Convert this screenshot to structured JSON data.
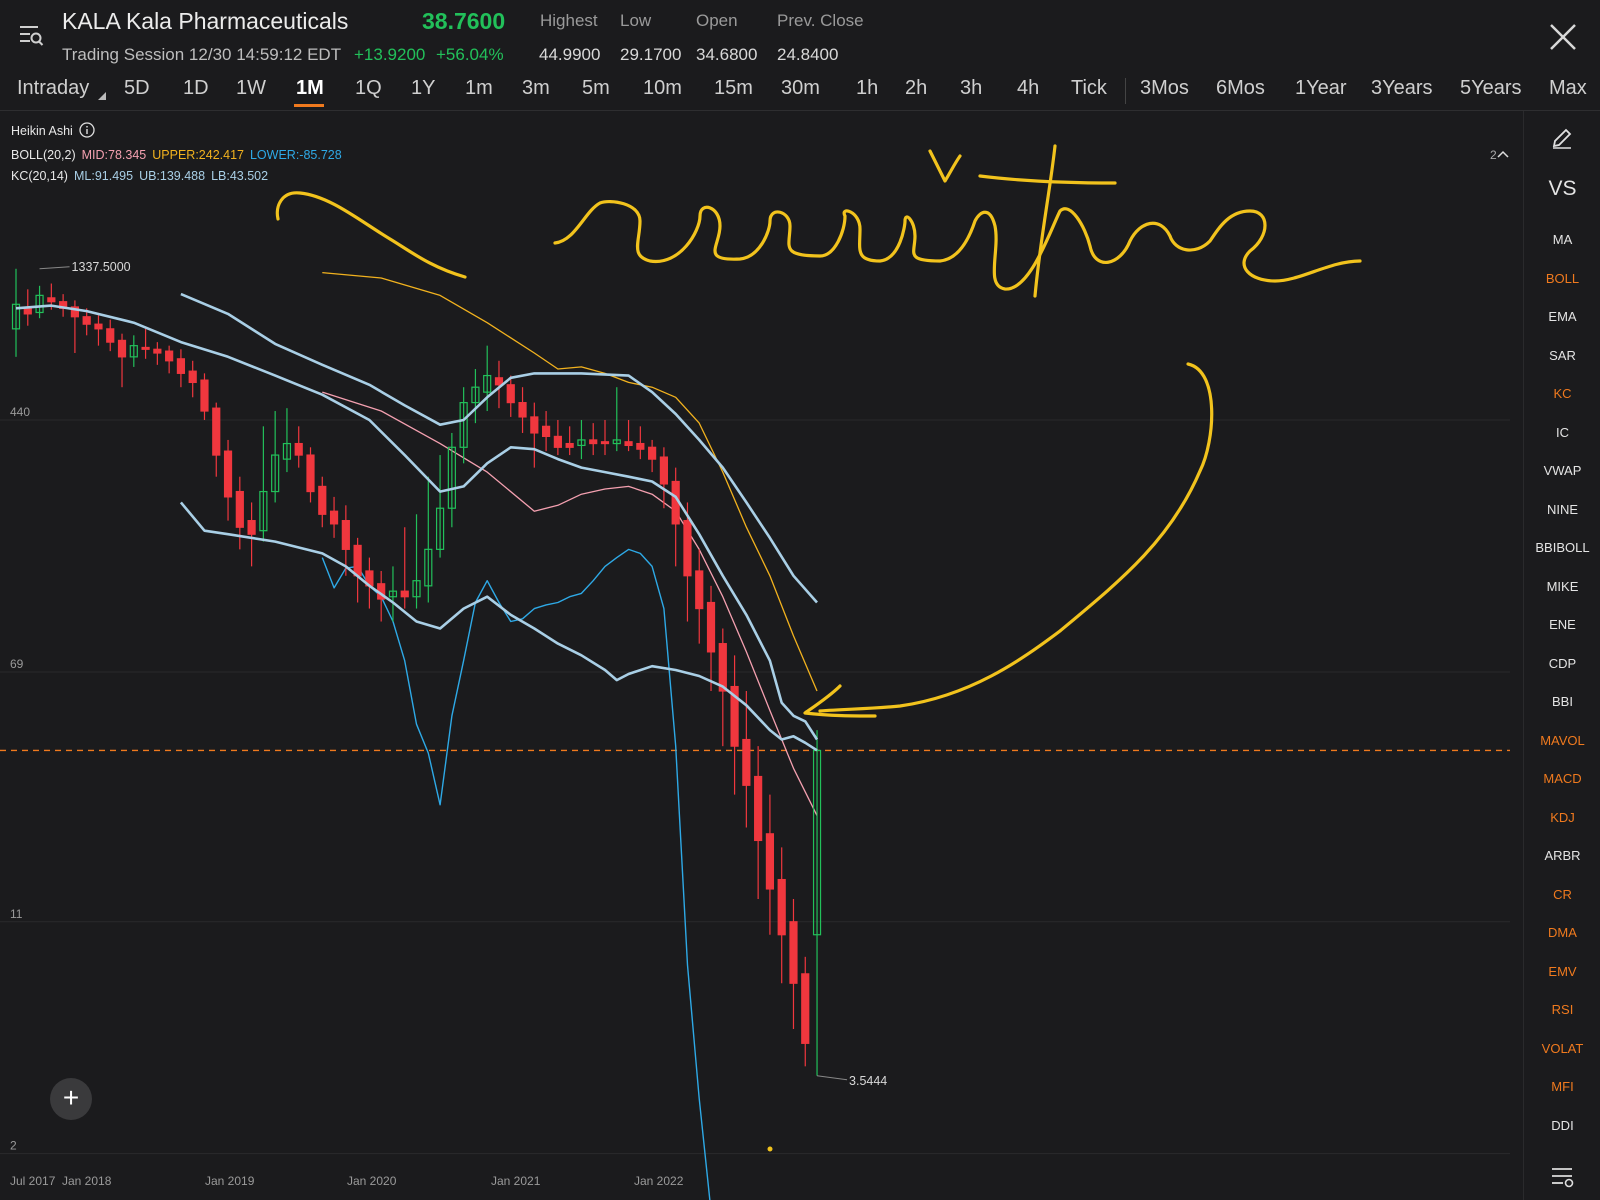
{
  "header": {
    "symbol": "KALA",
    "company": "Kala Pharmaceuticals",
    "session": "Trading Session 12/30 14:59:12 EDT",
    "price": "38.7600",
    "change": "+13.9200",
    "change_pct": "+56.04%",
    "stats": [
      {
        "label": "Highest",
        "value": "44.9900",
        "color": "#22c05a"
      },
      {
        "label": "Low",
        "value": "29.1700",
        "color": "#22c05a"
      },
      {
        "label": "Open",
        "value": "34.6800",
        "color": "#22c05a"
      },
      {
        "label": "Prev. Close",
        "value": "24.8400",
        "color": "#e8e8e8"
      }
    ]
  },
  "tabs": [
    "Intraday",
    "5D",
    "1D",
    "1W",
    "1M",
    "1Q",
    "1Y",
    "1m",
    "3m",
    "5m",
    "10m",
    "15m",
    "30m",
    "1h",
    "2h",
    "3h",
    "4h",
    "Tick",
    "3Mos",
    "6Mos",
    "1Year",
    "3Years",
    "5Years",
    "Max"
  ],
  "active_tab": "1M",
  "indicators": {
    "chart_type": "Heikin Ashi",
    "boll": {
      "name": "BOLL(20,2)",
      "mid": "MID:78.345",
      "upper": "UPPER:242.417",
      "lower": "LOWER:-85.728"
    },
    "kc": {
      "name": "KC(20,14)",
      "ml": "ML:91.495",
      "ub": "UB:139.488",
      "lb": "LB:43.502"
    },
    "collapse": "2"
  },
  "sidebar": {
    "top": [
      "VS"
    ],
    "items": [
      {
        "label": "MA",
        "on": false
      },
      {
        "label": "BOLL",
        "on": true
      },
      {
        "label": "EMA",
        "on": false
      },
      {
        "label": "SAR",
        "on": false
      },
      {
        "label": "KC",
        "on": true
      },
      {
        "label": "IC",
        "on": false
      },
      {
        "label": "VWAP",
        "on": false
      },
      {
        "label": "NINE",
        "on": false
      },
      {
        "label": "BBIBOLL",
        "on": false
      },
      {
        "label": "MIKE",
        "on": false
      },
      {
        "label": "ENE",
        "on": false
      },
      {
        "label": "CDP",
        "on": false
      },
      {
        "label": "BBI",
        "on": false
      },
      {
        "label": "MAVOL",
        "on": true
      },
      {
        "label": "MACD",
        "on": true
      },
      {
        "label": "KDJ",
        "on": true
      },
      {
        "label": "ARBR",
        "on": false
      },
      {
        "label": "CR",
        "on": true
      },
      {
        "label": "DMA",
        "on": true
      },
      {
        "label": "EMV",
        "on": true
      },
      {
        "label": "RSI",
        "on": true
      },
      {
        "label": "VOLAT",
        "on": true
      },
      {
        "label": "MFI",
        "on": true
      },
      {
        "label": "DDI",
        "on": false
      }
    ]
  },
  "annotation": {
    "text": "resistance",
    "color": "#f2c31d"
  },
  "colors": {
    "up": "#22c05a",
    "down": "#f0373e",
    "boll_mid": "#f4a0b0",
    "boll_upper": "#f2b21e",
    "boll_lower": "#2ea9e6",
    "kc": "#a9cfe6",
    "last_price_line": "#f07a1e"
  },
  "chart_data": {
    "type": "candlestick",
    "scale": "log",
    "y_ticks": [
      2,
      11,
      69,
      440
    ],
    "x_ticks": [
      "Jul 2017",
      "Jan 2018",
      "Jan 2019",
      "Jan 2020",
      "Jan 2021",
      "Jan 2022"
    ],
    "max_label": "1337.5000",
    "min_label": "3.5444",
    "last_price": 38.76,
    "candles": [
      {
        "o": 860,
        "c": 1030,
        "h": 1337.5,
        "l": 700
      },
      {
        "o": 1000,
        "c": 960,
        "h": 1150,
        "l": 880
      },
      {
        "o": 970,
        "c": 1100,
        "h": 1180,
        "l": 930
      },
      {
        "o": 1080,
        "c": 1050,
        "h": 1200,
        "l": 990
      },
      {
        "o": 1050,
        "c": 1000,
        "h": 1110,
        "l": 940
      },
      {
        "o": 1010,
        "c": 940,
        "h": 1060,
        "l": 720
      },
      {
        "o": 940,
        "c": 890,
        "h": 1000,
        "l": 820
      },
      {
        "o": 890,
        "c": 860,
        "h": 950,
        "l": 760
      },
      {
        "o": 860,
        "c": 780,
        "h": 920,
        "l": 730
      },
      {
        "o": 790,
        "c": 700,
        "h": 830,
        "l": 560
      },
      {
        "o": 700,
        "c": 760,
        "h": 820,
        "l": 650
      },
      {
        "o": 750,
        "c": 740,
        "h": 860,
        "l": 690
      },
      {
        "o": 740,
        "c": 720,
        "h": 780,
        "l": 660
      },
      {
        "o": 730,
        "c": 680,
        "h": 760,
        "l": 620
      },
      {
        "o": 690,
        "c": 620,
        "h": 740,
        "l": 560
      },
      {
        "o": 630,
        "c": 580,
        "h": 680,
        "l": 520
      },
      {
        "o": 590,
        "c": 470,
        "h": 620,
        "l": 440
      },
      {
        "o": 480,
        "c": 340,
        "h": 500,
        "l": 290
      },
      {
        "o": 350,
        "c": 250,
        "h": 380,
        "l": 210
      },
      {
        "o": 260,
        "c": 200,
        "h": 290,
        "l": 170
      },
      {
        "o": 210,
        "c": 190,
        "h": 240,
        "l": 150
      },
      {
        "o": 195,
        "c": 260,
        "h": 420,
        "l": 180
      },
      {
        "o": 260,
        "c": 340,
        "h": 470,
        "l": 240
      },
      {
        "o": 330,
        "c": 370,
        "h": 480,
        "l": 300
      },
      {
        "o": 370,
        "c": 340,
        "h": 420,
        "l": 310
      },
      {
        "o": 340,
        "c": 260,
        "h": 360,
        "l": 240
      },
      {
        "o": 270,
        "c": 220,
        "h": 290,
        "l": 200
      },
      {
        "o": 225,
        "c": 205,
        "h": 250,
        "l": 185
      },
      {
        "o": 210,
        "c": 170,
        "h": 235,
        "l": 140
      },
      {
        "o": 175,
        "c": 140,
        "h": 185,
        "l": 115
      },
      {
        "o": 145,
        "c": 130,
        "h": 160,
        "l": 110
      },
      {
        "o": 132,
        "c": 118,
        "h": 145,
        "l": 100
      },
      {
        "o": 120,
        "c": 125,
        "h": 150,
        "l": 100
      },
      {
        "o": 125,
        "c": 120,
        "h": 200,
        "l": 110
      },
      {
        "o": 120,
        "c": 135,
        "h": 220,
        "l": 110
      },
      {
        "o": 130,
        "c": 170,
        "h": 290,
        "l": 115
      },
      {
        "o": 170,
        "c": 230,
        "h": 340,
        "l": 160
      },
      {
        "o": 230,
        "c": 360,
        "h": 400,
        "l": 200
      },
      {
        "o": 360,
        "c": 500,
        "h": 560,
        "l": 320
      },
      {
        "o": 500,
        "c": 560,
        "h": 640,
        "l": 430
      },
      {
        "o": 540,
        "c": 610,
        "h": 760,
        "l": 470
      },
      {
        "o": 600,
        "c": 570,
        "h": 680,
        "l": 480
      },
      {
        "o": 570,
        "c": 500,
        "h": 610,
        "l": 450
      },
      {
        "o": 500,
        "c": 450,
        "h": 560,
        "l": 400
      },
      {
        "o": 450,
        "c": 400,
        "h": 500,
        "l": 310
      },
      {
        "o": 420,
        "c": 390,
        "h": 470,
        "l": 350
      },
      {
        "o": 390,
        "c": 360,
        "h": 440,
        "l": 340
      },
      {
        "o": 370,
        "c": 360,
        "h": 420,
        "l": 340
      },
      {
        "o": 365,
        "c": 380,
        "h": 440,
        "l": 330
      },
      {
        "o": 380,
        "c": 370,
        "h": 430,
        "l": 340
      },
      {
        "o": 375,
        "c": 370,
        "h": 440,
        "l": 340
      },
      {
        "o": 370,
        "c": 380,
        "h": 560,
        "l": 350
      },
      {
        "o": 375,
        "c": 365,
        "h": 440,
        "l": 350
      },
      {
        "o": 370,
        "c": 355,
        "h": 420,
        "l": 330
      },
      {
        "o": 360,
        "c": 330,
        "h": 380,
        "l": 300
      },
      {
        "o": 335,
        "c": 275,
        "h": 360,
        "l": 230
      },
      {
        "o": 280,
        "c": 205,
        "h": 310,
        "l": 150
      },
      {
        "o": 210,
        "c": 140,
        "h": 240,
        "l": 100
      },
      {
        "o": 145,
        "c": 110,
        "h": 170,
        "l": 85
      },
      {
        "o": 115,
        "c": 80,
        "h": 130,
        "l": 60
      },
      {
        "o": 85,
        "c": 60,
        "h": 95,
        "l": 40
      },
      {
        "o": 62,
        "c": 40,
        "h": 78,
        "l": 28
      },
      {
        "o": 42,
        "c": 30,
        "h": 60,
        "l": 22
      },
      {
        "o": 32,
        "c": 20,
        "h": 40,
        "l": 13
      },
      {
        "o": 21,
        "c": 14,
        "h": 28,
        "l": 10
      },
      {
        "o": 15,
        "c": 10,
        "h": 19,
        "l": 7
      },
      {
        "o": 11,
        "c": 7,
        "h": 13,
        "l": 5
      },
      {
        "o": 7.5,
        "c": 4.5,
        "h": 8.5,
        "l": 3.8
      },
      {
        "o": 10,
        "c": 38.76,
        "h": 44.99,
        "l": 3.5444
      }
    ],
    "boll_upper": [
      [
        26,
        1300
      ],
      [
        31,
        1250
      ],
      [
        36,
        1100
      ],
      [
        40,
        900
      ],
      [
        44,
        720
      ],
      [
        46,
        640
      ],
      [
        48,
        650
      ],
      [
        50,
        620
      ],
      [
        52,
        580
      ],
      [
        54,
        560
      ],
      [
        56,
        520
      ],
      [
        58,
        430
      ],
      [
        60,
        300
      ],
      [
        62,
        200
      ],
      [
        64,
        140
      ],
      [
        66,
        90
      ],
      [
        68,
        60
      ]
    ],
    "boll_mid": [
      [
        26,
        540
      ],
      [
        31,
        470
      ],
      [
        36,
        370
      ],
      [
        40,
        300
      ],
      [
        44,
        225
      ],
      [
        46,
        235
      ],
      [
        48,
        255
      ],
      [
        50,
        265
      ],
      [
        52,
        270
      ],
      [
        54,
        255
      ],
      [
        56,
        225
      ],
      [
        58,
        170
      ],
      [
        60,
        120
      ],
      [
        62,
        80
      ],
      [
        64,
        52
      ],
      [
        66,
        34
      ],
      [
        68,
        24
      ]
    ],
    "boll_lower": [
      [
        26,
        160
      ],
      [
        27,
        128
      ],
      [
        28,
        148
      ],
      [
        29,
        150
      ],
      [
        30,
        130
      ],
      [
        31,
        120
      ],
      [
        32,
        100
      ],
      [
        33,
        75
      ],
      [
        34,
        47
      ],
      [
        35,
        38
      ],
      [
        36,
        26
      ],
      [
        37,
        50
      ],
      [
        38,
        75
      ],
      [
        39,
        115
      ],
      [
        40,
        135
      ],
      [
        41,
        115
      ],
      [
        42,
        100
      ],
      [
        43,
        102
      ],
      [
        44,
        110
      ],
      [
        45,
        113
      ],
      [
        46,
        115
      ],
      [
        47,
        120
      ],
      [
        48,
        123
      ],
      [
        49,
        135
      ],
      [
        50,
        150
      ],
      [
        51,
        160
      ],
      [
        52,
        170
      ],
      [
        53,
        165
      ],
      [
        54,
        150
      ],
      [
        55,
        110
      ],
      [
        56,
        40
      ],
      [
        57,
        8
      ],
      [
        58,
        3
      ],
      [
        59,
        0.9
      ]
    ],
    "kc_upper": [
      [
        14,
        1110
      ],
      [
        18,
        960
      ],
      [
        22,
        770
      ],
      [
        26,
        660
      ],
      [
        30,
        570
      ],
      [
        33,
        490
      ],
      [
        36,
        425
      ],
      [
        38,
        440
      ],
      [
        40,
        520
      ],
      [
        42,
        600
      ],
      [
        44,
        620
      ],
      [
        48,
        620
      ],
      [
        52,
        610
      ],
      [
        54,
        540
      ],
      [
        56,
        460
      ],
      [
        58,
        380
      ],
      [
        60,
        310
      ],
      [
        62,
        240
      ],
      [
        64,
        185
      ],
      [
        66,
        140
      ],
      [
        68,
        115
      ]
    ],
    "kc_mid": [
      [
        0,
        1000
      ],
      [
        3,
        1020
      ],
      [
        6,
        980
      ],
      [
        10,
        900
      ],
      [
        14,
        780
      ],
      [
        18,
        700
      ],
      [
        22,
        610
      ],
      [
        26,
        530
      ],
      [
        30,
        440
      ],
      [
        33,
        340
      ],
      [
        36,
        260
      ],
      [
        38,
        270
      ],
      [
        40,
        320
      ],
      [
        42,
        360
      ],
      [
        44,
        355
      ],
      [
        46,
        330
      ],
      [
        48,
        310
      ],
      [
        50,
        300
      ],
      [
        52,
        290
      ],
      [
        54,
        280
      ],
      [
        56,
        250
      ],
      [
        58,
        190
      ],
      [
        60,
        140
      ],
      [
        62,
        105
      ],
      [
        64,
        75
      ],
      [
        65,
        55
      ],
      [
        66,
        50
      ],
      [
        67,
        48
      ],
      [
        68,
        42
      ]
    ],
    "kc_lower": [
      [
        14,
        240
      ],
      [
        16,
        195
      ],
      [
        18,
        190
      ],
      [
        22,
        180
      ],
      [
        26,
        165
      ],
      [
        28,
        150
      ],
      [
        30,
        130
      ],
      [
        32,
        115
      ],
      [
        34,
        100
      ],
      [
        36,
        95
      ],
      [
        38,
        110
      ],
      [
        40,
        120
      ],
      [
        42,
        105
      ],
      [
        44,
        95
      ],
      [
        46,
        85
      ],
      [
        48,
        78
      ],
      [
        50,
        70
      ],
      [
        51,
        65
      ],
      [
        52,
        68
      ],
      [
        54,
        72
      ],
      [
        56,
        70
      ],
      [
        58,
        67
      ],
      [
        60,
        62
      ],
      [
        62,
        54
      ],
      [
        64,
        45
      ],
      [
        65,
        42
      ],
      [
        66,
        43
      ],
      [
        67,
        41
      ],
      [
        68,
        38.8
      ]
    ]
  }
}
